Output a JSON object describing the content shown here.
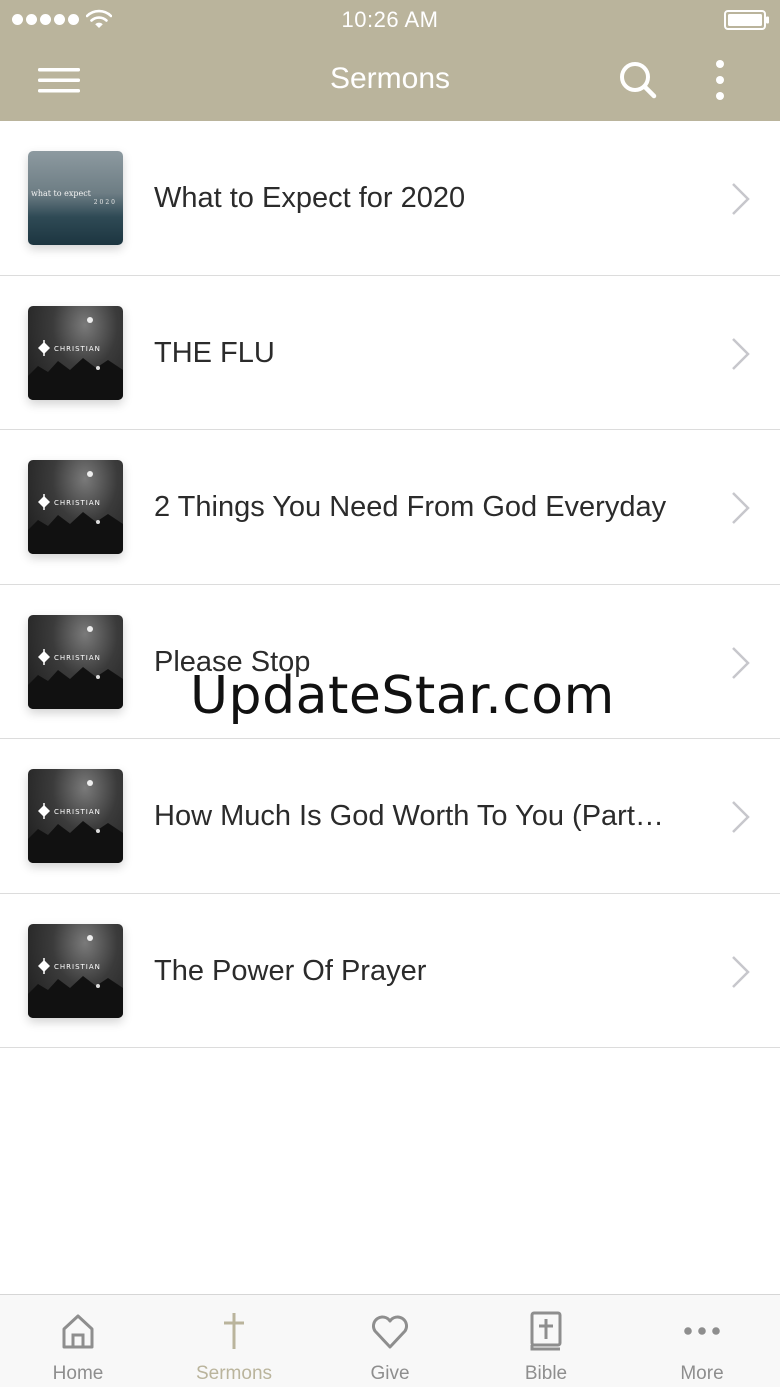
{
  "status_bar": {
    "time": "10:26 AM"
  },
  "nav": {
    "title": "Sermons"
  },
  "thumb_text": {
    "expect_line1": "what to expect",
    "expect_line2": "2020",
    "christian": "CHRISTIAN"
  },
  "sermons": [
    {
      "title": "What to Expect for 2020",
      "thumb": "what-to-expect-thumbnail"
    },
    {
      "title": "THE FLU",
      "thumb": "christian-thumbnail"
    },
    {
      "title": "2 Things You Need From God Everyday",
      "thumb": "christian-thumbnail"
    },
    {
      "title": "Please Stop",
      "thumb": "christian-thumbnail"
    },
    {
      "title": "How Much Is God Worth To You (Part…",
      "thumb": "christian-thumbnail"
    },
    {
      "title": "The Power Of Prayer",
      "thumb": "christian-thumbnail"
    }
  ],
  "watermark": "UpdateStar.com",
  "tabs": [
    {
      "label": "Home",
      "icon": "home-icon"
    },
    {
      "label": "Sermons",
      "icon": "cross-icon",
      "active": true
    },
    {
      "label": "Give",
      "icon": "heart-icon"
    },
    {
      "label": "Bible",
      "icon": "bible-icon"
    },
    {
      "label": "More",
      "icon": "more-dots-icon"
    }
  ],
  "colors": {
    "accent": "#bab49c",
    "tab_inactive": "#8e8e8e",
    "text": "#2b2b2b",
    "divider": "#dcdcdc"
  }
}
